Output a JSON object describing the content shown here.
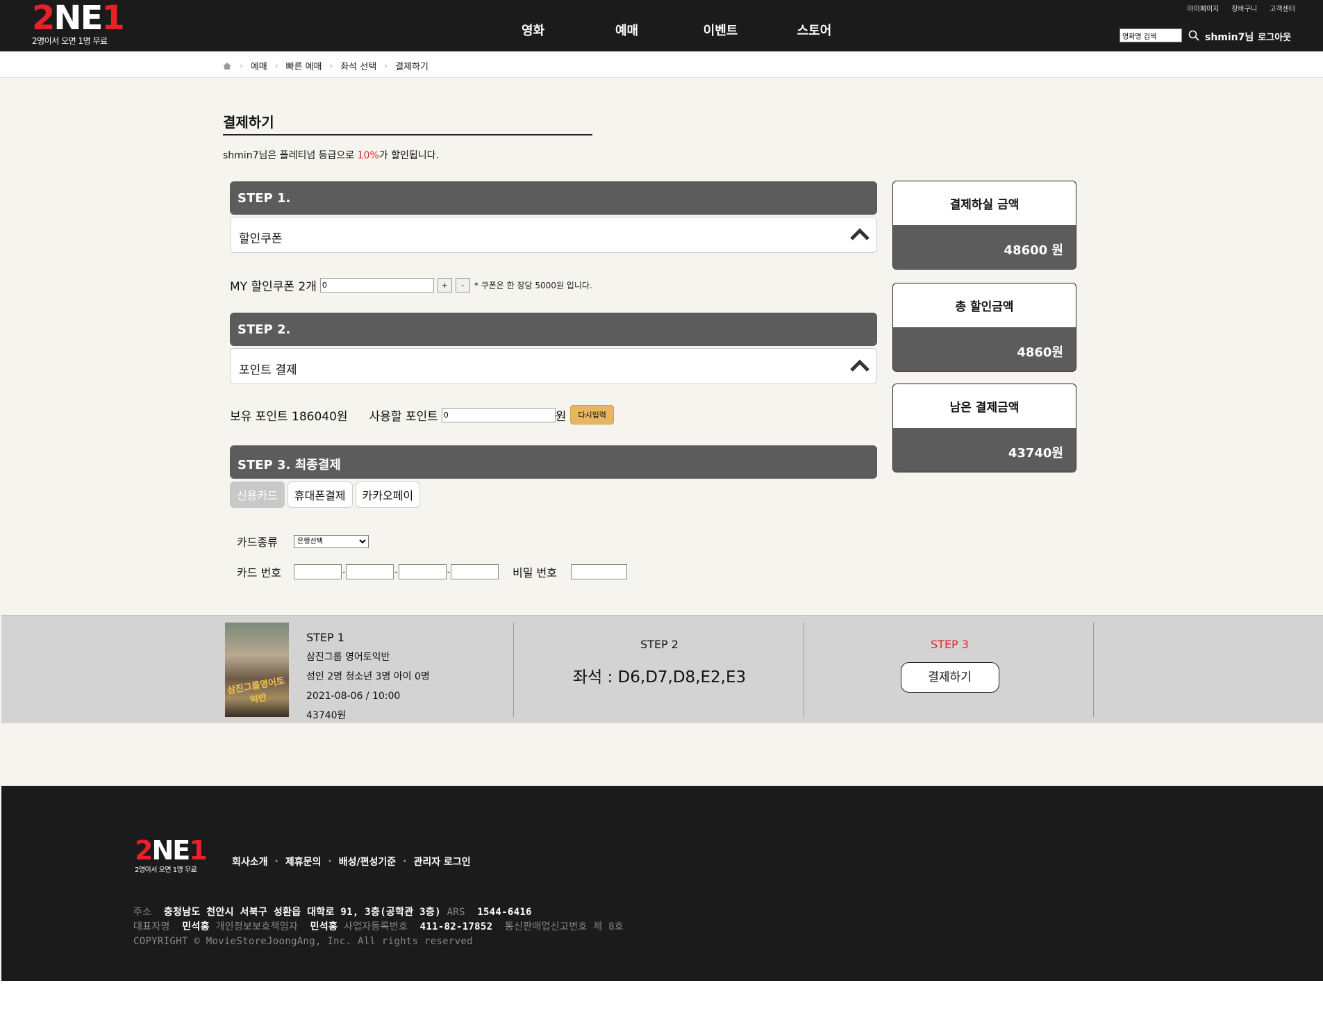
{
  "header": {
    "logo_main_a": "2",
    "logo_main_b": "NE",
    "logo_main_c": "1",
    "logo_sub": "2명이서 오면 1명 무료",
    "nav": [
      "영화",
      "예매",
      "이벤트",
      "스토어"
    ],
    "util": [
      "마이페이지",
      "장바구니",
      "고객센터"
    ],
    "search_placeholder": "영화명 검색",
    "user": "shmin7님",
    "logout": "로그아웃"
  },
  "breadcrumb": [
    "예매",
    "빠른 예매",
    "좌석 선택",
    "결제하기"
  ],
  "page": {
    "title": "결제하기",
    "grade_msg_a": "shmin7님은 플레티넘 등급으로 ",
    "grade_pct": "10%",
    "grade_msg_b": "가 할인됩니다."
  },
  "step1": {
    "bar": "STEP 1.",
    "acc_label": "할인쿠폰",
    "coupon_label": "MY 할인쿠폰 2개",
    "coupon_value": "0",
    "plus": "+",
    "minus": "-",
    "note": "* 쿠폰은 한 장당 5000원 입니다."
  },
  "step2": {
    "bar": "STEP 2.",
    "acc_label": "포인트 결제",
    "owned": "보유 포인트 186040원",
    "use_label": "사용할 포인트",
    "use_value": "0",
    "unit": "원",
    "reset": "다시입력"
  },
  "step3": {
    "bar": "STEP 3. 최종결제",
    "tabs": [
      "신용카드",
      "휴대폰결제",
      "카카오페이"
    ],
    "card_type_label": "카드종류",
    "card_type_value": "은행선택",
    "card_num_label": "카드 번호",
    "password_label": "비밀 번호"
  },
  "summary": [
    {
      "label": "결제하실 금액",
      "value": "48600 원"
    },
    {
      "label": "총 할인금액",
      "value": "4860원"
    },
    {
      "label": "남은 결제금액",
      "value": "43740원"
    }
  ],
  "strip": {
    "step1": "STEP 1",
    "movie": "삼진그룹 영어토익반",
    "people": "성인 2명 청소년 3명 아이 0명",
    "datetime": "2021-08-06  / 10:00",
    "price": "43740원",
    "poster_text": "삼진그룹영어토익반",
    "step2": "STEP 2",
    "seats": "좌석 : D6,D7,D8,E2,E3",
    "step3": "STEP 3",
    "pay_button": "결제하기"
  },
  "footer": {
    "links": [
      "회사소개",
      "제휴문의",
      "배성/편성기준",
      "관리자 로그인"
    ],
    "addr_label": "주소",
    "addr": "충청남도 천안시 서북구 성환읍 대학로 91, 3층(공학관 3층)",
    "ars_label": "ARS",
    "ars": "1544-6416",
    "ceo_label": "대표자명",
    "ceo": "민석홍",
    "privacy_label": "개인정보보호책임자",
    "privacy": "민석홍",
    "biz_label": "사업자등록번호",
    "biz": "411-82-17852",
    "mail_order": "통신판매업신고번호 제 8호",
    "copyright": "COPYRIGHT © MovieStoreJoongAng, Inc. All rights reserved"
  },
  "colors": {
    "header_bg": "#1b1b1b",
    "step_bar": "#5c5c5c",
    "accent_red": "#e3222b",
    "reset_btn": "#e8b560"
  }
}
